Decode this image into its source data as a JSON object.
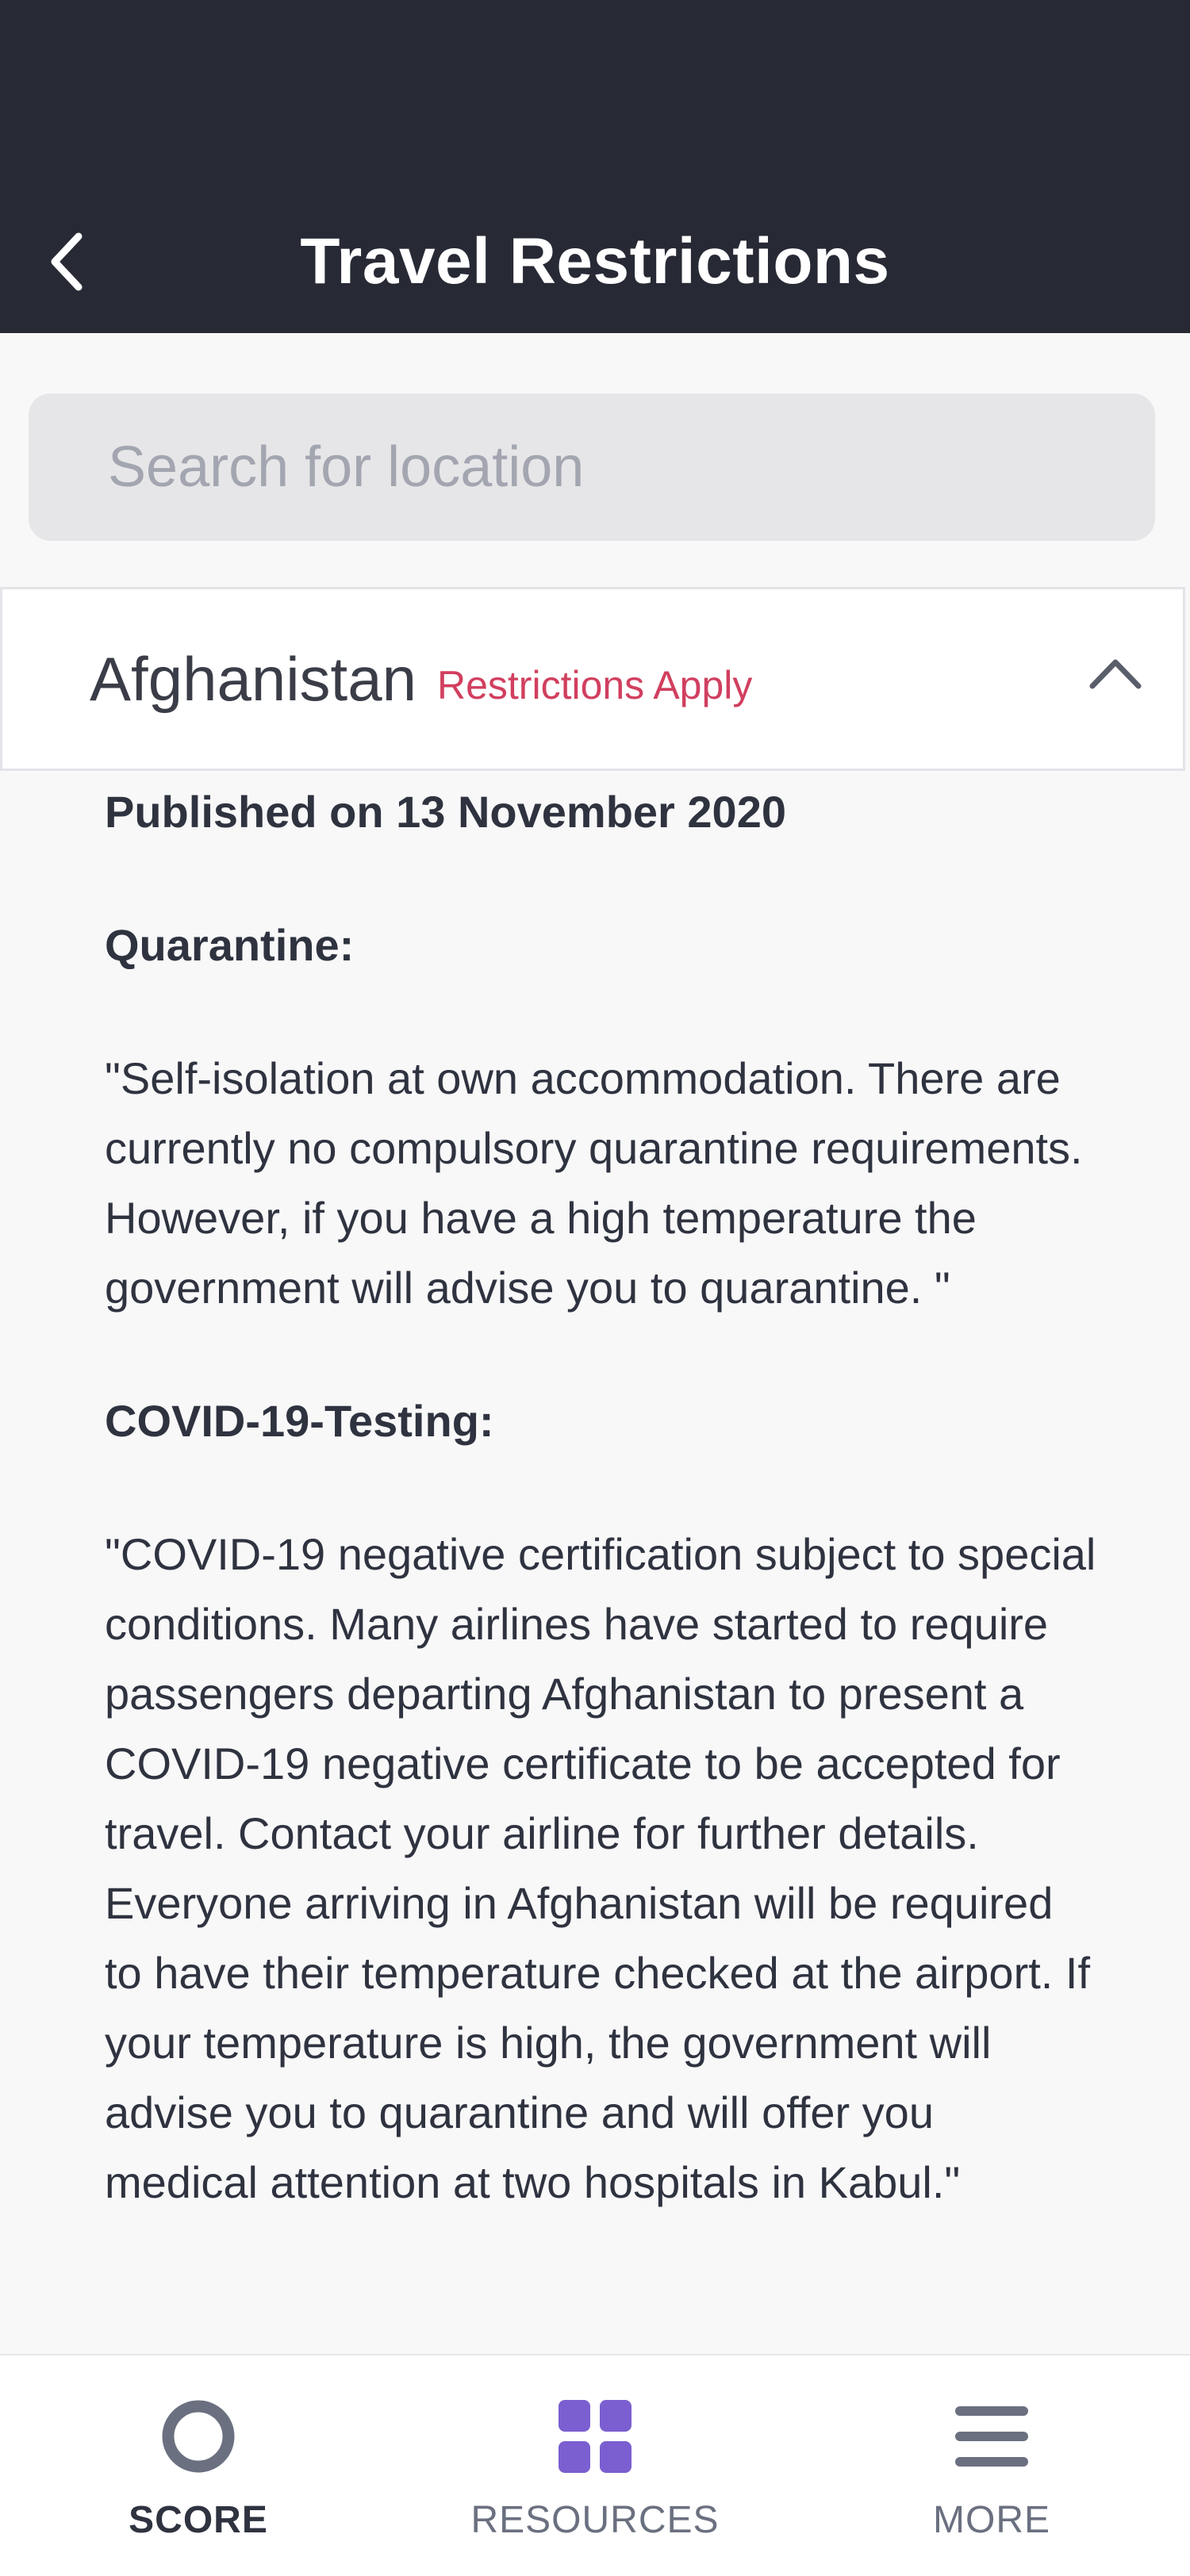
{
  "header": {
    "title": "Travel Restrictions",
    "back_icon": "chevron-left-icon"
  },
  "search": {
    "placeholder": "Search for location",
    "value": ""
  },
  "country": {
    "name": "Afghanistan",
    "status": "Restrictions Apply",
    "status_color": "#d13f5f",
    "expanded": true
  },
  "details": {
    "published": "Published on 13 November 2020",
    "sections": [
      {
        "heading": "Quarantine:",
        "body": "\"Self-isolation at own accommodation. There are currently no compulsory quarantine requirements. However, if you have a high temperature the government will advise you to quarantine. \""
      },
      {
        "heading": "COVID-19-Testing:",
        "body": "\"COVID-19 negative certification subject to special conditions. Many airlines have started to require passengers departing Afghanistan to present a COVID-19 negative certificate to be accepted for travel. Contact your airline for further details. Everyone arriving in Afghanistan will be required to have their temperature checked at the airport. If your temperature is high, the government will advise you to quarantine and will offer you medical attention at two hospitals in Kabul.\""
      }
    ]
  },
  "bottom_nav": {
    "items": [
      {
        "label": "SCORE",
        "icon": "score-ring-icon",
        "active": true
      },
      {
        "label": "RESOURCES",
        "icon": "grid-icon",
        "active": false
      },
      {
        "label": "MORE",
        "icon": "hamburger-menu-icon",
        "active": false
      }
    ]
  },
  "colors": {
    "header_bg": "#272a35",
    "accent_purple": "#7b5fd0",
    "restriction_red": "#d13f5f"
  }
}
